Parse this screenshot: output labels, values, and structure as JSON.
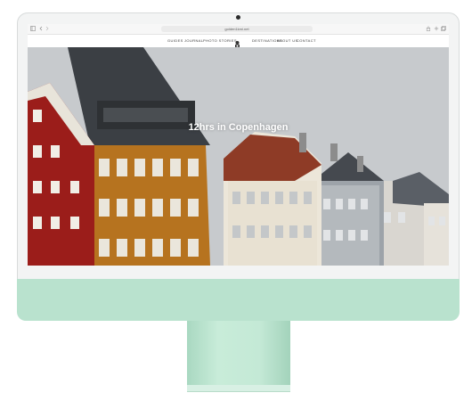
{
  "browser": {
    "url": "golden1kmi.net",
    "back_icon": "chevron-left-icon",
    "forward_icon": "chevron-right-icon",
    "share_icon": "share-icon",
    "new_tab_icon": "plus-icon",
    "tabs_icon": "tabs-icon"
  },
  "nav": {
    "items_left": [
      "GUIDES",
      "JOURNAL",
      "PHOTO STORIES"
    ],
    "logo": "compass-logo-icon",
    "items_right": [
      "DESTINATIONS",
      "ABOUT US",
      "CONTACT"
    ]
  },
  "hero": {
    "title": "12hrs in Copenhagen"
  },
  "colors": {
    "monitor_accent": "#b9e2ce",
    "bezel": "#f3f4f4"
  }
}
